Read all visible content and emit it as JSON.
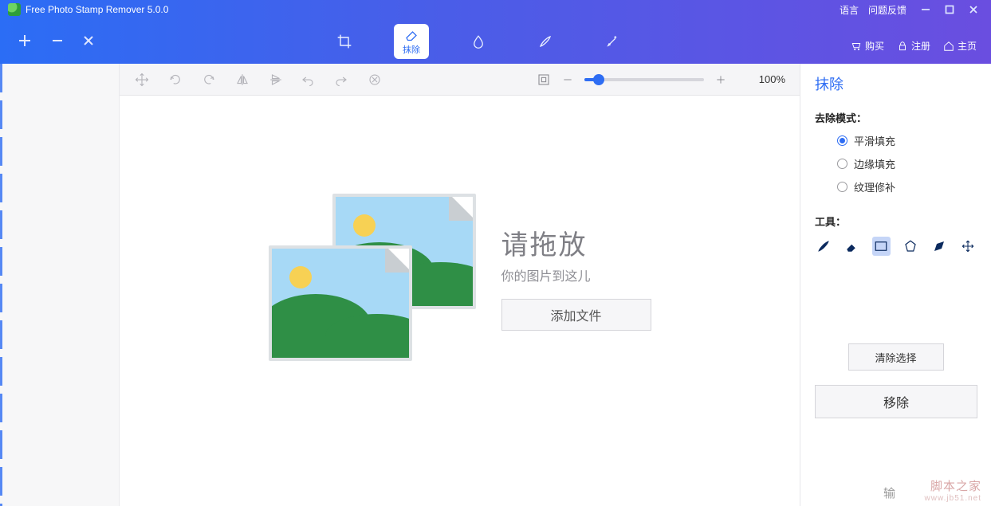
{
  "app": {
    "title": "Free Photo Stamp Remover 5.0.0"
  },
  "titlebar_links": {
    "language": "语言",
    "feedback": "问题反馈"
  },
  "main_tools": {
    "erase_label": "抹除"
  },
  "header_links": {
    "cart": "购买",
    "register": "注册",
    "home": "主页"
  },
  "zoom": {
    "value": "100%"
  },
  "dropzone": {
    "heading": "请拖放",
    "sub": "你的图片到这儿",
    "add_button": "添加文件"
  },
  "panel": {
    "title": "抹除",
    "mode_label": "去除模式：",
    "modes": {
      "smooth": "平滑填充",
      "edge": "边缘填充",
      "texture": "纹理修补"
    },
    "tools_label": "工具：",
    "clear_selection": "清除选择",
    "remove": "移除",
    "output_label": "输"
  },
  "watermark": {
    "text": "脚本之家",
    "url": "www.jb51.net"
  }
}
